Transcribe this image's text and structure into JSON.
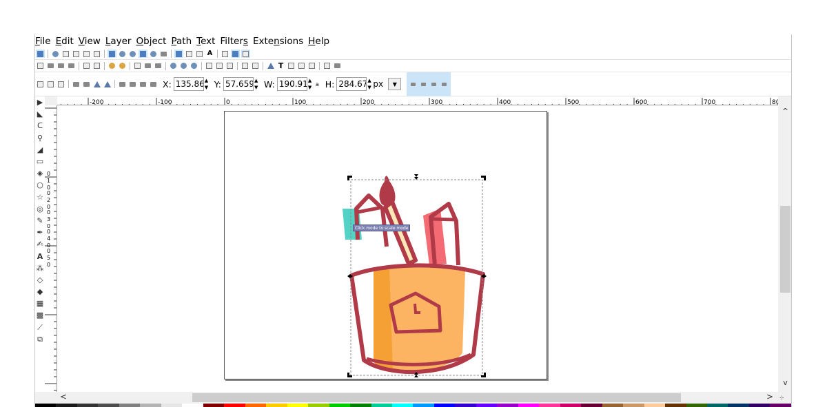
{
  "menu": {
    "items": [
      {
        "pre": "",
        "ul": "F",
        "post": "ile"
      },
      {
        "pre": "",
        "ul": "E",
        "post": "dit"
      },
      {
        "pre": "",
        "ul": "V",
        "post": "iew"
      },
      {
        "pre": "",
        "ul": "L",
        "post": "ayer"
      },
      {
        "pre": "",
        "ul": "O",
        "post": "bject"
      },
      {
        "pre": "",
        "ul": "P",
        "post": "ath"
      },
      {
        "pre": "",
        "ul": "T",
        "post": "ext"
      },
      {
        "pre": "Filter",
        "ul": "s",
        "post": ""
      },
      {
        "pre": "Exte",
        "ul": "n",
        "post": "sions"
      },
      {
        "pre": "",
        "ul": "H",
        "post": "elp"
      }
    ]
  },
  "toolbar_select": {
    "x_label": "X:",
    "x_value": "135.862",
    "y_label": "Y:",
    "y_value": "57.659",
    "w_label": "W:",
    "w_value": "190.919",
    "h_label": "H:",
    "h_value": "284.677",
    "unit": "px",
    "lock_glyph": "a"
  },
  "ruler": {
    "h_labels": [
      "-200",
      "-100",
      "0",
      "100",
      "200",
      "300",
      "400",
      "500",
      "600",
      "700",
      "80"
    ],
    "v_labels": [
      "0",
      "1",
      "0",
      "0",
      "2",
      "0",
      "0",
      "3",
      "0",
      "0",
      "4",
      "0",
      "0",
      "5",
      "0"
    ]
  },
  "canvas": {
    "tooltip": "Click mode to scale mode"
  },
  "colors": {
    "cup_orange": "#fdb462",
    "cup_shadow": "#f5a035",
    "outline_red": "#b03a48",
    "teal": "#52d3c5",
    "pink": "#f46b74",
    "cream": "#fde8b8",
    "selection_blue": "#cce4f7"
  },
  "palette": [
    "#000000",
    "#1a1a1a",
    "#333333",
    "#4d4d4d",
    "#808080",
    "#b3b3b3",
    "#e6e6e6",
    "#ffffff",
    "#800000",
    "#ff0000",
    "#ff6600",
    "#ffcc00",
    "#ffff00",
    "#99cc00",
    "#00cc00",
    "#008000",
    "#00cc99",
    "#00ffff",
    "#0099ff",
    "#0000ff",
    "#3300cc",
    "#6600ff",
    "#9900cc",
    "#ff00ff",
    "#ff3399",
    "#cc0066",
    "#660033",
    "#996633",
    "#cc9966",
    "#ffcc99",
    "#663300",
    "#336600",
    "#006666",
    "#003366",
    "#330066",
    "#660066"
  ]
}
